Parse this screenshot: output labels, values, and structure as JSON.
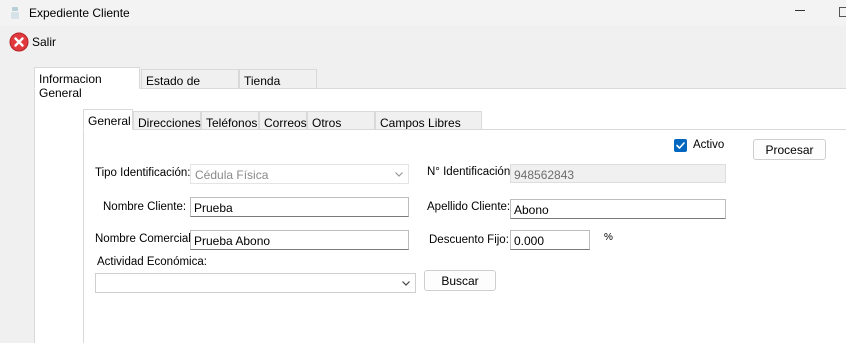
{
  "window": {
    "title": "Expediente Cliente"
  },
  "toolbar": {
    "exit_label": "Salir",
    "exit_icon": "close-circle-icon"
  },
  "tabs_main": [
    {
      "label": "Informacion General",
      "active": true
    },
    {
      "label": "Estado de Cuenta",
      "active": false
    },
    {
      "label": "Tienda Virtual",
      "active": false
    }
  ],
  "tabs_sub": [
    {
      "label": "General",
      "active": true
    },
    {
      "label": "Direcciones",
      "active": false
    },
    {
      "label": "Teléfonos",
      "active": false
    },
    {
      "label": "Correos",
      "active": false
    },
    {
      "label": "Otros Datos",
      "active": false
    },
    {
      "label": "Campos Libres XML",
      "active": false
    }
  ],
  "form": {
    "activo_label": "Activo",
    "activo_checked": true,
    "procesar_label": "Procesar",
    "tipo_identificacion_label": "Tipo Identificación:",
    "tipo_identificacion_value": "Cédula Física",
    "identificacion_label": "N° Identificación:",
    "identificacion_value": "948562843",
    "nombre_cliente_label": "Nombre Cliente:",
    "nombre_cliente_value": "Prueba",
    "apellido_cliente_label": "Apellido Cliente:",
    "apellido_cliente_value": "Abono",
    "nombre_comercial_label": "Nombre Comercial:",
    "nombre_comercial_value": "Prueba Abono",
    "descuento_fijo_label": "Descuento Fijo:",
    "descuento_fijo_value": "0.000",
    "percent_label": "%",
    "actividad_label": "Actividad Económica:",
    "actividad_value": "",
    "buscar_label": "Buscar"
  },
  "colors": {
    "checkbox_accent": "#0067c0",
    "exit_icon": "#e0393e"
  }
}
